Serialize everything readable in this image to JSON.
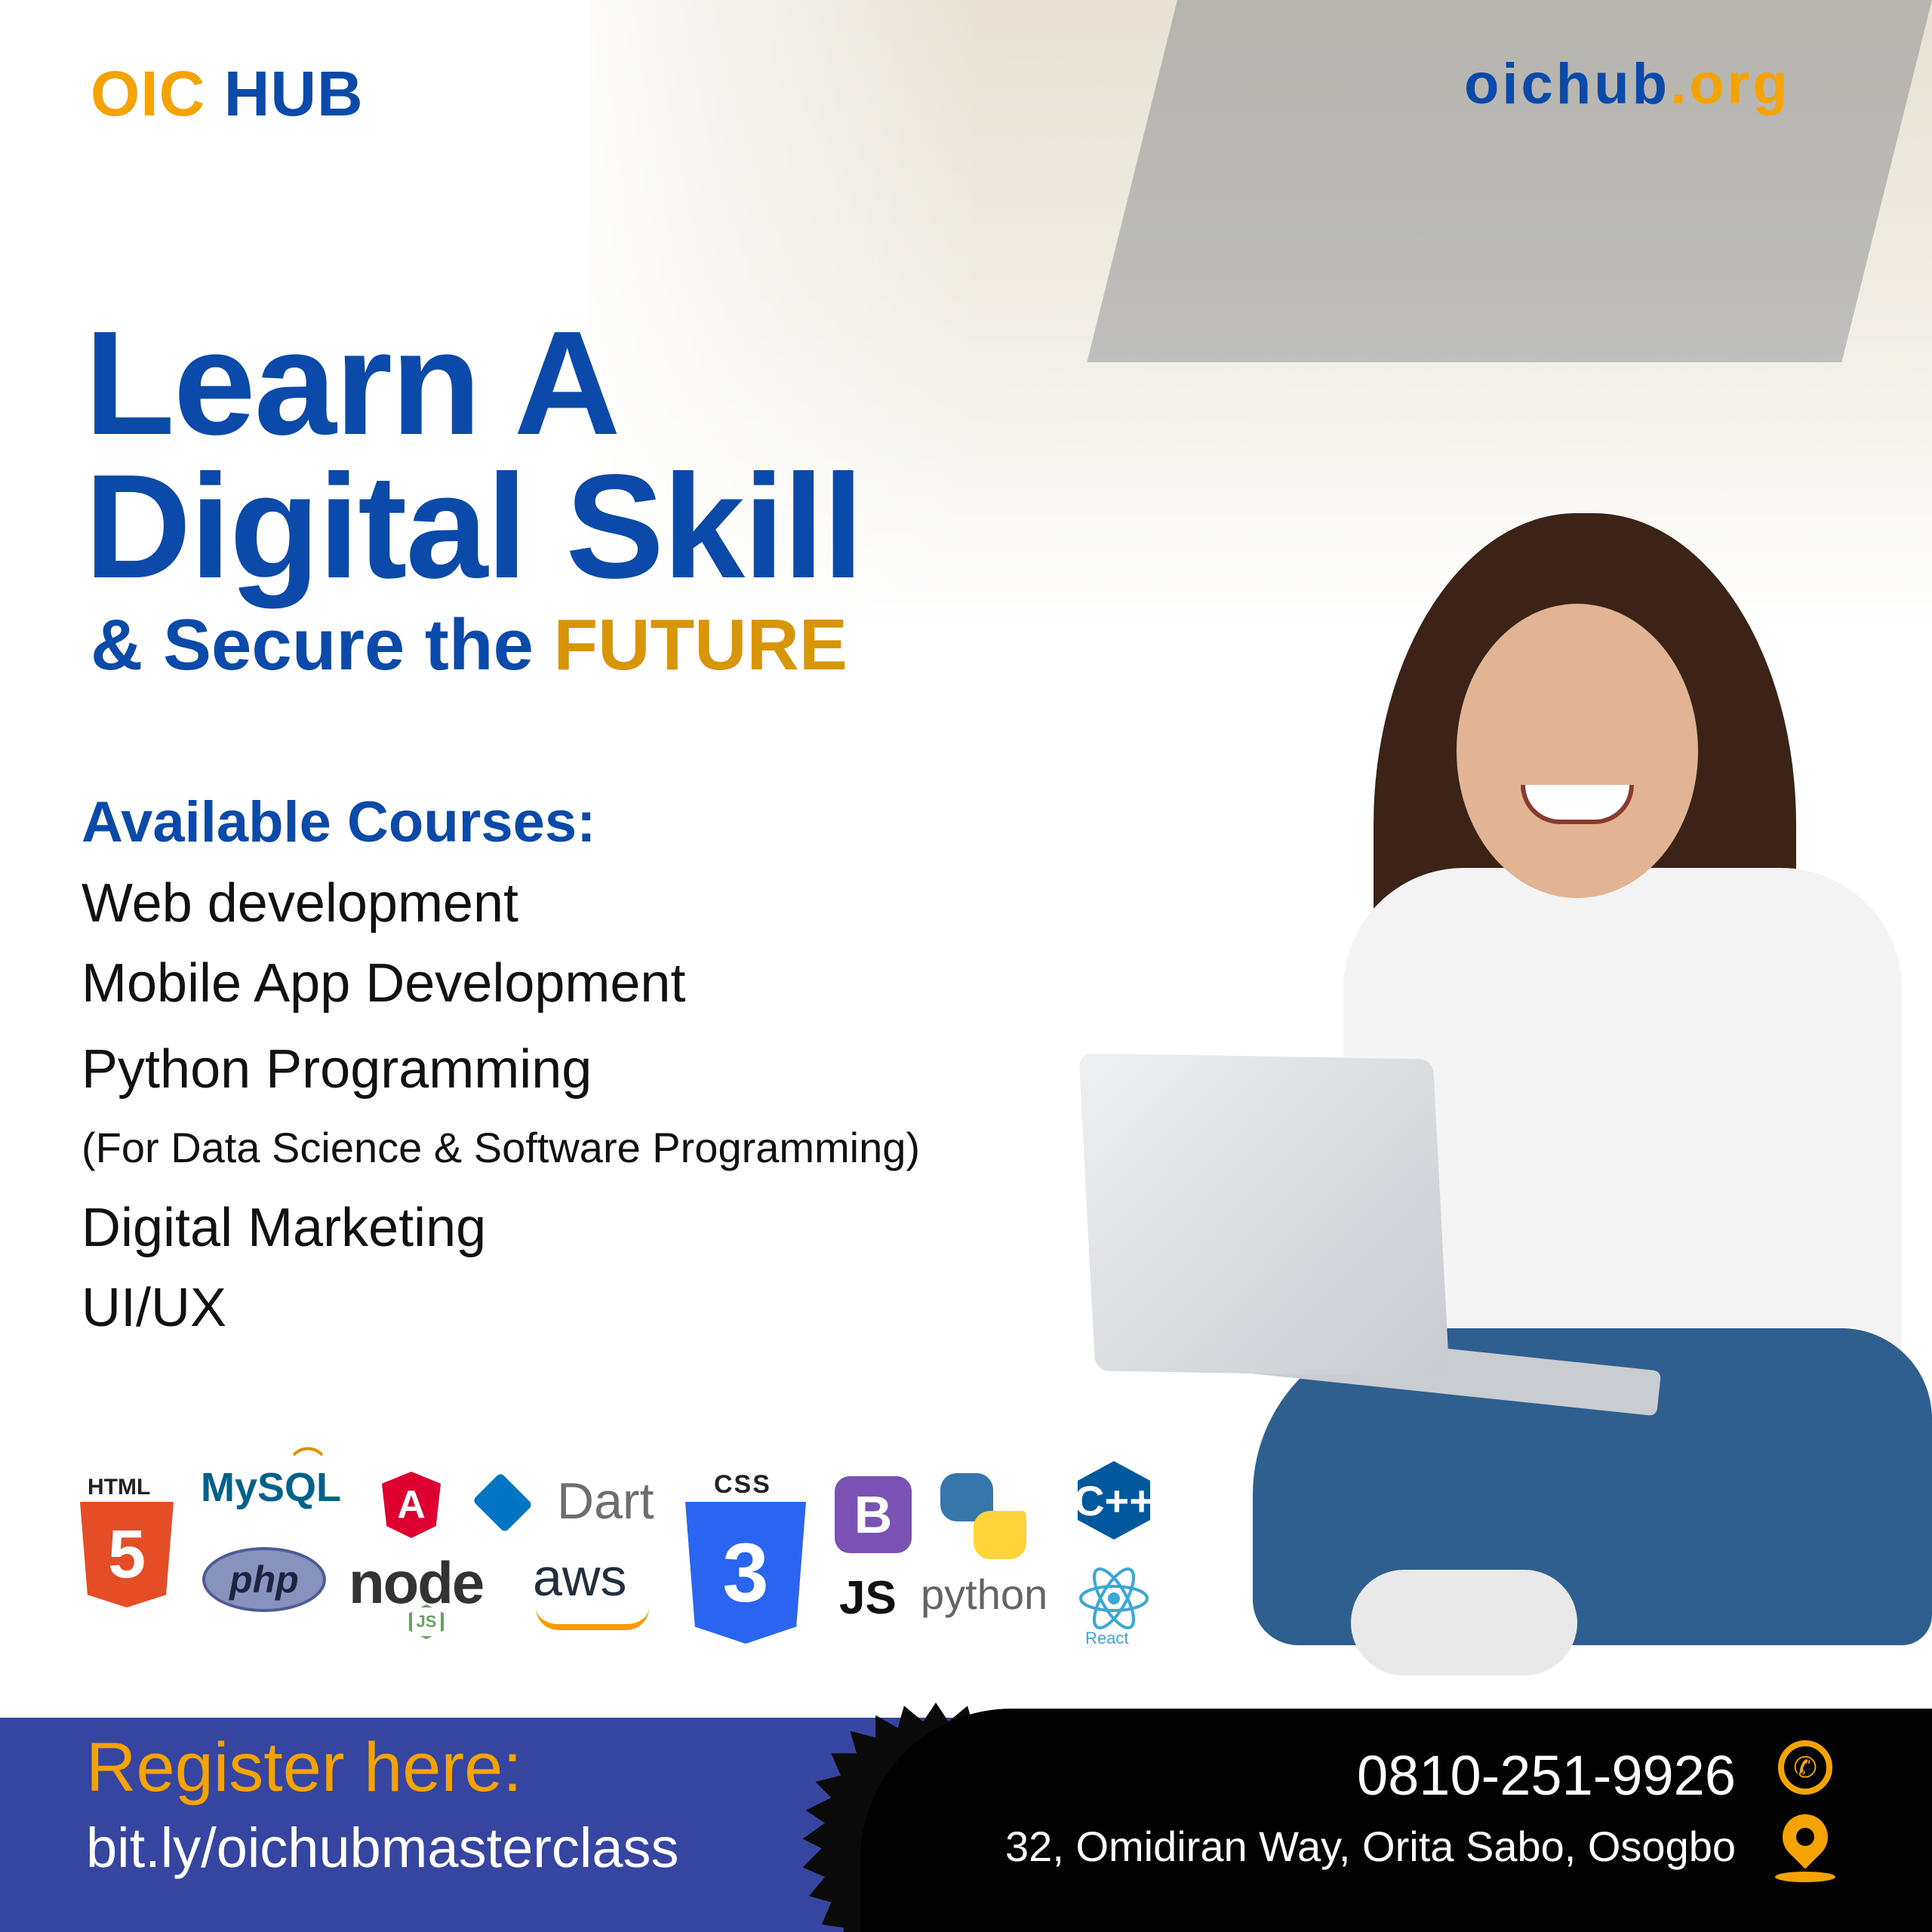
{
  "brand": {
    "part1": "OIC",
    "part2": "HUB"
  },
  "website": {
    "part1": "oichub",
    "part2": ".org"
  },
  "headline": {
    "line1": "Learn A",
    "line2": "Digital Skill",
    "line3_prefix": "& Secure the",
    "line3_highlight": "FUTURE"
  },
  "courses": {
    "title": "Available Courses:",
    "items": [
      "Web development",
      "Mobile App Development",
      "Python Programming",
      "(For Data Science & Software Programming)",
      "Digital Marketing",
      "UI/UX"
    ]
  },
  "tech_logos": {
    "html_label": "HTML",
    "html_mark": "5",
    "mysql": "MySQL",
    "angular": "A",
    "dart": "Dart",
    "php": "php",
    "node": "node",
    "node_js": "JS",
    "aws": "aws",
    "css_label": "CSS",
    "css_mark": "3",
    "bootstrap": "B",
    "js": "JS",
    "python": "python",
    "cpp": "C++",
    "react": "React"
  },
  "footer": {
    "register_label": "Register here:",
    "register_link": "bit.ly/oichubmasterclass",
    "phone": "0810-251-9926",
    "address": "32, Omidiran Way, Orita Sabo, Osogbo"
  },
  "colors": {
    "primary_blue": "#0b4aa8",
    "accent_orange": "#f5a300",
    "future_gold": "#d99508",
    "footer_blue": "#3645a0",
    "footer_black": "#020202"
  },
  "icons": [
    "phone-icon",
    "location-pin-icon"
  ]
}
